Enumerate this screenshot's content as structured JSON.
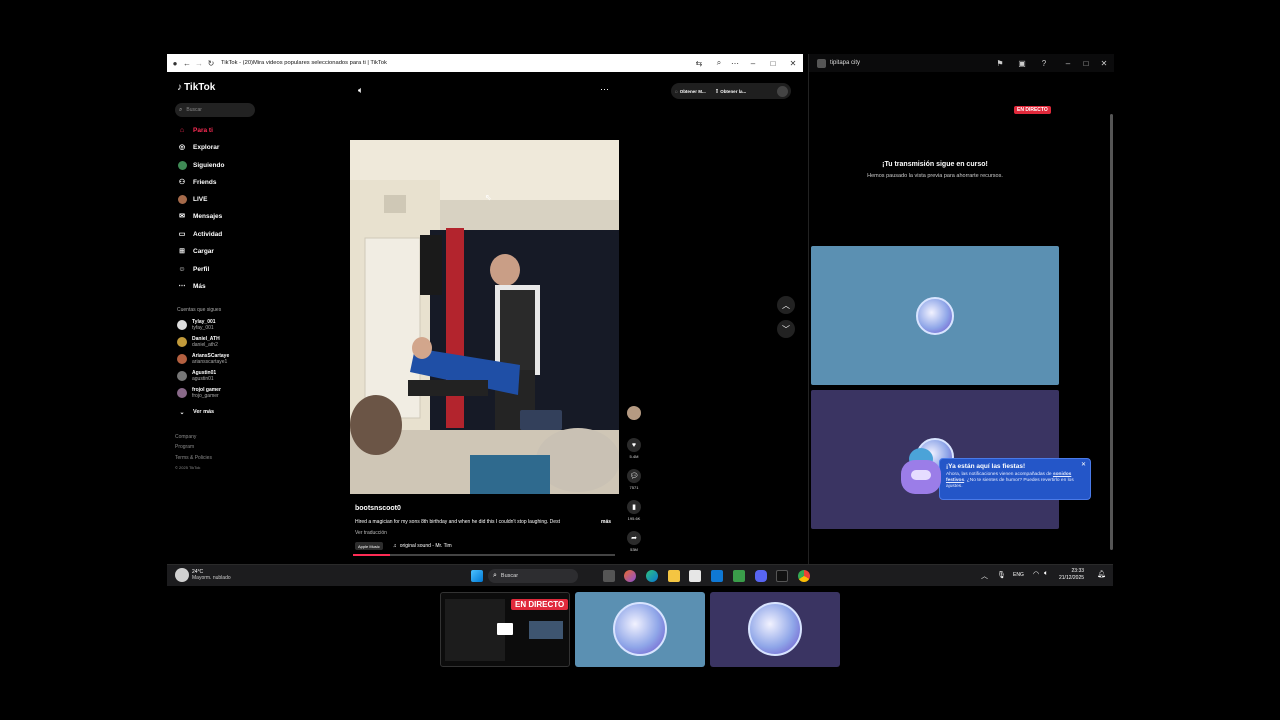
{
  "browser": {
    "tab_title": "TikTok - (20)Mira videos populares seleccionados para ti | TikTok"
  },
  "tiktok": {
    "logo": "TikTok",
    "search_placeholder": "Buscar",
    "nav": [
      "Para ti",
      "Explorar",
      "Siguiendo",
      "Friends",
      "LIVE",
      "Mensajes",
      "Actividad",
      "Cargar",
      "Perfil",
      "Más"
    ],
    "following_heading": "Cuentas que sigues",
    "accounts": [
      {
        "name": "Tylay_001",
        "handle": "tyfay_001"
      },
      {
        "name": "Daniel_ATH",
        "handle": "daniel_ath2"
      },
      {
        "name": "AriansSCartaye",
        "handle": "ariansscartaye1"
      },
      {
        "name": "Agustin01",
        "handle": "agustin01"
      },
      {
        "name": "frojol gamer",
        "handle": "frojo_gamer"
      }
    ],
    "see_more": "Ver más",
    "footer": [
      "Company",
      "Program",
      "Terms & Policies",
      "© 2025 TikTok"
    ],
    "top_buttons": [
      "Obtener M...",
      "Obtener la..."
    ],
    "video": {
      "author": "bootsnscoot0",
      "caption": "Hired a magician for my sons 8th birthday and when he did this I couldn't stop laughing. Dest",
      "more": "más",
      "translate": "Ver traducción",
      "music_badge": "Apple Music",
      "sound": "original sound - Mr. Tim",
      "likes": "5.4M",
      "comments": "7571",
      "saves": "195.6K",
      "shares": "53M"
    }
  },
  "discord": {
    "title": "tipitapa city",
    "live_badge": "EN DIRECTO",
    "stream_title": "¡Tu transmisión sigue en curso!",
    "stream_sub": "Hemos pausado la vista previa para ahorrarte recursos.",
    "toast_title": "¡Ya están aquí las fiestas!",
    "toast_body_1": "Ahora, las notificaciones vienen acompañadas de",
    "toast_body_bold": "sonidos festivos",
    "toast_body_2": ". ¿No te sientes de humor? Puedes revertirlo en los ajustes.",
    "colors": {
      "tile_top": "#5b90b2",
      "tile_bottom": "#3a3462",
      "toast": "#2456c8"
    }
  },
  "taskbar": {
    "weather_temp": "24°C",
    "weather_desc": "Mayorm. nublado",
    "search": "Buscar",
    "lang": "ENG",
    "time": "23:33",
    "date": "21/12/2025"
  },
  "thumbnails": {
    "live_badge": "EN DIRECTO"
  }
}
